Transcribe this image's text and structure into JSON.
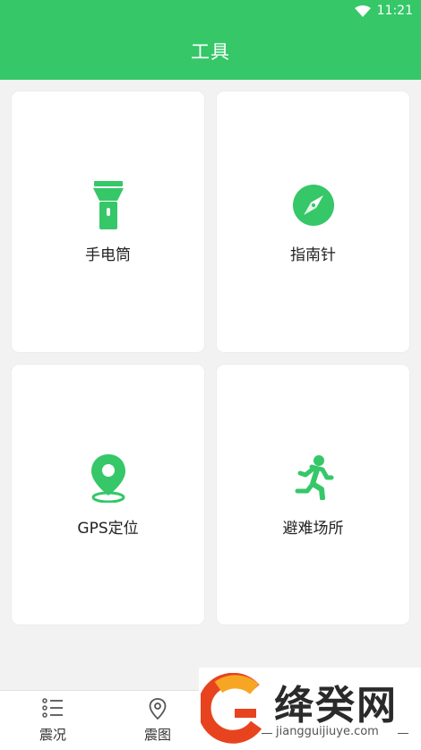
{
  "status_bar": {
    "time": "11:21"
  },
  "header": {
    "title": "工具"
  },
  "tools": [
    {
      "label": "手电筒",
      "icon": "flashlight-icon"
    },
    {
      "label": "指南针",
      "icon": "compass-icon"
    },
    {
      "label": "GPS定位",
      "icon": "location-pin-icon"
    },
    {
      "label": "避难场所",
      "icon": "running-person-icon"
    }
  ],
  "tabbar": {
    "items": [
      {
        "label": "震况",
        "icon": "list-icon"
      },
      {
        "label": "震图",
        "icon": "map-pin-icon"
      }
    ]
  },
  "watermark": {
    "text": "绛癸网",
    "url": "jiangguijiuye.com"
  },
  "colors": {
    "accent": "#35c768"
  }
}
